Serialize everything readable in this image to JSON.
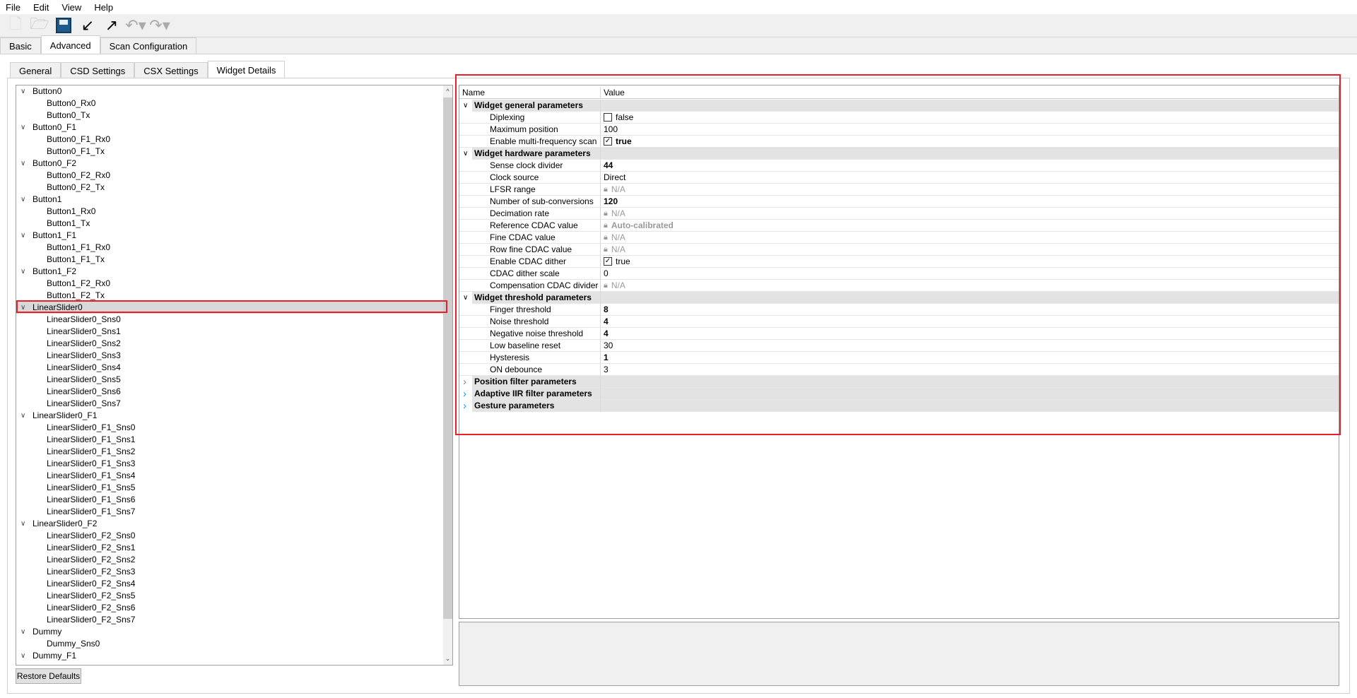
{
  "menu": [
    "File",
    "Edit",
    "View",
    "Help"
  ],
  "toolbar": {
    "icons": [
      "new-file-icon",
      "open-folder-icon",
      "save-icon",
      "import-icon",
      "export-icon",
      "undo-icon",
      "redo-icon"
    ]
  },
  "main_tabs": [
    {
      "label": "Basic"
    },
    {
      "label": "Advanced",
      "active": true
    },
    {
      "label": "Scan Configuration"
    }
  ],
  "sub_tabs": [
    {
      "label": "General"
    },
    {
      "label": "CSD Settings"
    },
    {
      "label": "CSX Settings"
    },
    {
      "label": "Widget Details",
      "active": true
    }
  ],
  "tree": [
    {
      "label": "Button0",
      "children": [
        "Button0_Rx0",
        "Button0_Tx"
      ]
    },
    {
      "label": "Button0_F1",
      "children": [
        "Button0_F1_Rx0",
        "Button0_F1_Tx"
      ]
    },
    {
      "label": "Button0_F2",
      "children": [
        "Button0_F2_Rx0",
        "Button0_F2_Tx"
      ]
    },
    {
      "label": "Button1",
      "children": [
        "Button1_Rx0",
        "Button1_Tx"
      ]
    },
    {
      "label": "Button1_F1",
      "children": [
        "Button1_F1_Rx0",
        "Button1_F1_Tx"
      ]
    },
    {
      "label": "Button1_F2",
      "children": [
        "Button1_F2_Rx0",
        "Button1_F2_Tx"
      ]
    },
    {
      "label": "LinearSlider0",
      "selected": true,
      "children": [
        "LinearSlider0_Sns0",
        "LinearSlider0_Sns1",
        "LinearSlider0_Sns2",
        "LinearSlider0_Sns3",
        "LinearSlider0_Sns4",
        "LinearSlider0_Sns5",
        "LinearSlider0_Sns6",
        "LinearSlider0_Sns7"
      ]
    },
    {
      "label": "LinearSlider0_F1",
      "children": [
        "LinearSlider0_F1_Sns0",
        "LinearSlider0_F1_Sns1",
        "LinearSlider0_F1_Sns2",
        "LinearSlider0_F1_Sns3",
        "LinearSlider0_F1_Sns4",
        "LinearSlider0_F1_Sns5",
        "LinearSlider0_F1_Sns6",
        "LinearSlider0_F1_Sns7"
      ]
    },
    {
      "label": "LinearSlider0_F2",
      "children": [
        "LinearSlider0_F2_Sns0",
        "LinearSlider0_F2_Sns1",
        "LinearSlider0_F2_Sns2",
        "LinearSlider0_F2_Sns3",
        "LinearSlider0_F2_Sns4",
        "LinearSlider0_F2_Sns5",
        "LinearSlider0_F2_Sns6",
        "LinearSlider0_F2_Sns7"
      ]
    },
    {
      "label": "Dummy",
      "children": [
        "Dummy_Sns0"
      ]
    },
    {
      "label": "Dummy_F1",
      "children": []
    }
  ],
  "restore_label": "Restore Defaults",
  "grid": {
    "headers": {
      "name": "Name",
      "value": "Value"
    },
    "groups": [
      {
        "label": "Widget general parameters",
        "expanded": true,
        "items": [
          {
            "name": "Diplexing",
            "value": "false",
            "checkbox": false
          },
          {
            "name": "Maximum position",
            "value": "100"
          },
          {
            "name": "Enable multi-frequency scan",
            "value": "true",
            "checkbox": true,
            "bold": true
          }
        ]
      },
      {
        "label": "Widget hardware parameters",
        "expanded": true,
        "items": [
          {
            "name": "Sense clock divider",
            "value": "44",
            "bold": true
          },
          {
            "name": "Clock source",
            "value": "Direct"
          },
          {
            "name": "LFSR range",
            "value": "N/A",
            "locked": true
          },
          {
            "name": "Number of sub-conversions",
            "value": "120",
            "bold": true
          },
          {
            "name": "Decimation rate",
            "value": "N/A",
            "locked": true
          },
          {
            "name": "Reference CDAC value",
            "value": "Auto-calibrated",
            "locked": true,
            "bold": true
          },
          {
            "name": "Fine CDAC value",
            "value": "N/A",
            "locked": true
          },
          {
            "name": "Row fine CDAC value",
            "value": "N/A",
            "locked": true
          },
          {
            "name": "Enable CDAC dither",
            "value": "true",
            "checkbox": true
          },
          {
            "name": "CDAC dither scale",
            "value": "0"
          },
          {
            "name": "Compensation CDAC divider",
            "value": "N/A",
            "locked": true
          }
        ]
      },
      {
        "label": "Widget threshold parameters",
        "expanded": true,
        "items": [
          {
            "name": "Finger threshold",
            "value": "8",
            "bold": true
          },
          {
            "name": "Noise threshold",
            "value": "4",
            "bold": true
          },
          {
            "name": "Negative noise threshold",
            "value": "4",
            "bold": true
          },
          {
            "name": "Low baseline reset",
            "value": "30"
          },
          {
            "name": "Hysteresis",
            "value": "1",
            "bold": true
          },
          {
            "name": "ON debounce",
            "value": "3"
          }
        ]
      },
      {
        "label": "Position filter parameters",
        "expanded": false,
        "chevron_color": "#888888",
        "items": []
      },
      {
        "label": "Adaptive IIR filter parameters",
        "expanded": false,
        "chevron_color": "#1ba1e2",
        "items": []
      },
      {
        "label": "Gesture parameters",
        "expanded": false,
        "chevron_color": "#1ba1e2",
        "items": []
      }
    ]
  },
  "highlight_color": "#e8202a"
}
